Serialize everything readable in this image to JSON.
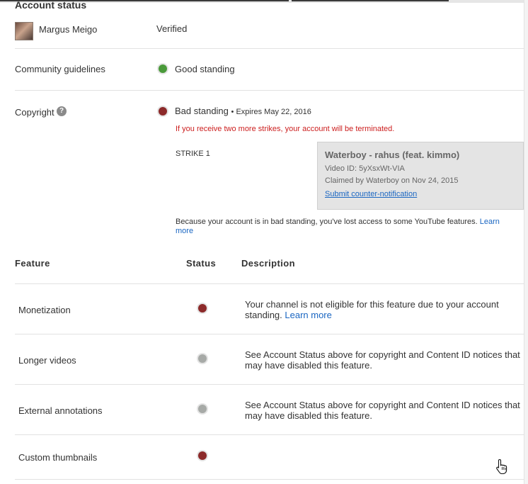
{
  "account_status": {
    "section_title": "Account status",
    "user_name": "Margus Meigo",
    "verified_label": "Verified"
  },
  "community": {
    "label": "Community guidelines",
    "status": "Good standing",
    "status_color": "#4a9a3a"
  },
  "copyright": {
    "label": "Copyright",
    "help_symbol": "?",
    "status": "Bad standing",
    "expires": "• Expires May 22, 2016",
    "status_color": "#8c2a2a",
    "warning": "If you receive two more strikes, your account will be terminated.",
    "strike_label": "STRIKE 1",
    "strike": {
      "video_title": "Waterboy - rahus (feat. kimmo)",
      "video_id": "Video ID: 5yXsxWt-VIA",
      "claimed_by": "Claimed by Waterboy on Nov 24, 2015",
      "action_link": "Submit counter-notification"
    },
    "notice_text": "Because your account is in bad standing, you've lost access to some YouTube features.",
    "notice_link": "Learn more"
  },
  "features_table": {
    "headers": {
      "feature": "Feature",
      "status": "Status",
      "description": "Description"
    },
    "rows": [
      {
        "feature": "Monetization",
        "status": "red",
        "description": "Your channel is not eligible for this feature due to your account standing.",
        "link": "Learn more"
      },
      {
        "feature": "Longer videos",
        "status": "grey",
        "description": "See Account Status above for copyright and Content ID notices that may have disabled this feature."
      },
      {
        "feature": "External annotations",
        "status": "grey",
        "description": "See Account Status above for copyright and Content ID notices that may have disabled this feature."
      },
      {
        "feature": "Custom thumbnails",
        "status": "red",
        "description": ""
      }
    ]
  },
  "icons": {
    "cursor": "hand-pointer-icon",
    "help": "question-circle-icon"
  }
}
